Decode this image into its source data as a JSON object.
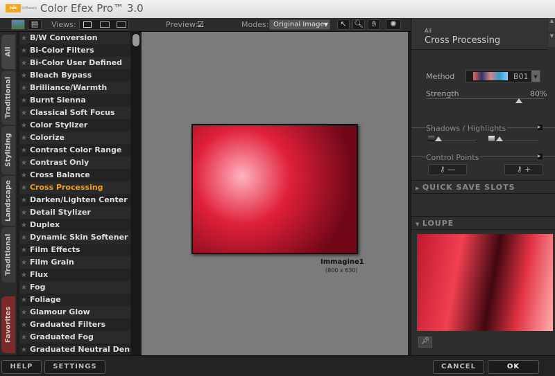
{
  "app": {
    "title": "Color Efex Pro™ 3.0",
    "logo": "nik",
    "logo_sub": "Software"
  },
  "toolbar": {
    "views_label": "Views:",
    "preview_label": "Preview:",
    "preview_checked": true,
    "modes_label": "Modes:",
    "modes_value": "Original Image"
  },
  "tabs": [
    "All",
    "Traditional",
    "Stylizing",
    "Landscape",
    "Traditional",
    "Favorites"
  ],
  "filters": [
    "B/W Conversion",
    "Bi-Color Filters",
    "Bi-Color User Defined",
    "Bleach Bypass",
    "Brilliance/Warmth",
    "Burnt Sienna",
    "Classical Soft Focus",
    "Color Stylizer",
    "Colorize",
    "Contrast Color Range",
    "Contrast Only",
    "Cross Balance",
    "Cross Processing",
    "Darken/Lighten Center",
    "Detail Stylizer",
    "Duplex",
    "Dynamic Skin Softener",
    "Film Effects",
    "Film Grain",
    "Flux",
    "Fog",
    "Foliage",
    "Glamour Glow",
    "Graduated Filters",
    "Graduated Fog",
    "Graduated Neutral Density"
  ],
  "selected_filter": "Cross Processing",
  "image": {
    "name": "Immagine1",
    "size": "(800 x 630)"
  },
  "panel": {
    "category": "All",
    "filter": "Cross Processing",
    "method_label": "Method",
    "method_value": "B01",
    "strength_label": "Strength",
    "strength_value": "80%",
    "strength": 80,
    "shadows_label": "Shadows / Highlights",
    "control_points_label": "Control Points",
    "quick_save": "QUICK SAVE SLOTS",
    "loupe": "LOUPE"
  },
  "bottom": {
    "help": "HELP",
    "settings": "SETTINGS",
    "cancel": "CANCEL",
    "ok": "OK"
  },
  "colors": {
    "accent": "#f0a020"
  }
}
